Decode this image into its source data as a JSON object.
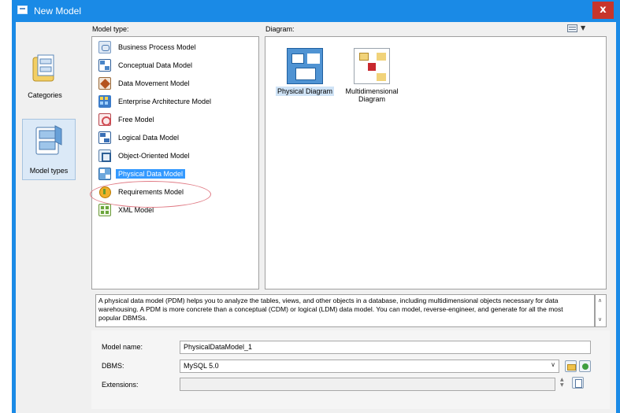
{
  "window": {
    "title": "New Model",
    "close_label": "x"
  },
  "nav": {
    "items": [
      {
        "label": "Categories",
        "icon": "categories-icon"
      },
      {
        "label": "Model types",
        "icon": "model-types-icon",
        "selected": true
      }
    ]
  },
  "model_type": {
    "label": "Model type:",
    "items": [
      {
        "label": "Business Process Model"
      },
      {
        "label": "Conceptual Data Model"
      },
      {
        "label": "Data Movement Model"
      },
      {
        "label": "Enterprise Architecture Model"
      },
      {
        "label": "Free Model"
      },
      {
        "label": "Logical Data Model"
      },
      {
        "label": "Object-Oriented Model"
      },
      {
        "label": "Physical Data Model",
        "selected": true
      },
      {
        "label": "Requirements Model"
      },
      {
        "label": "XML Model"
      }
    ]
  },
  "diagram": {
    "label": "Diagram:",
    "items": [
      {
        "label": "Physical Diagram",
        "selected": true
      },
      {
        "label": "Multidimensional Diagram"
      }
    ]
  },
  "description": "A physical data model (PDM) helps you to analyze the tables, views, and other objects in a database, including multidimensional objects necessary for data warehousing. A PDM is more concrete than a conceptual (CDM) or logical (LDM) data model. You can model, reverse-engineer, and generate for all the most popular DBMSs.",
  "form": {
    "model_name_label": "Model name:",
    "model_name_value": "PhysicalDataModel_1",
    "dbms_label": "DBMS:",
    "dbms_value": "MySQL 5.0",
    "extensions_label": "Extensions:",
    "extensions_value": ""
  },
  "colors": {
    "titlebar": "#1a8ae6",
    "close": "#c7352b",
    "selection": "#3399ff",
    "annotation_ellipse": "#e07a84"
  }
}
